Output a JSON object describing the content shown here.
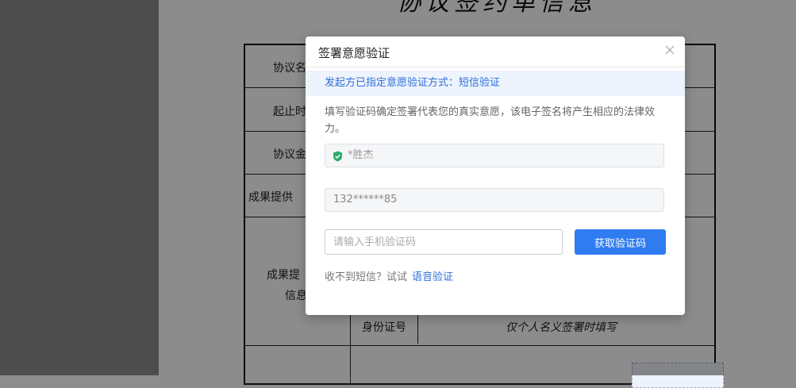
{
  "document": {
    "title": "协议签约单信息",
    "labels": [
      "协议名",
      "起止时",
      "协议金",
      "成果提供",
      "成果提",
      "信息",
      "身份证号"
    ],
    "id_note": "仅个人名义签署时填写"
  },
  "modal": {
    "title": "签署意愿验证",
    "notice": "发起方已指定意愿验证方式：短信验证",
    "description": "填写验证码确定签署代表您的真实意愿，该电子签名将产生相应的法律效力。",
    "name_value": "*胜杰",
    "phone_value": "132******85",
    "code_placeholder": "请输入手机验证码",
    "get_code_label": "获取验证码",
    "no_sms_text": "收不到短信？试试",
    "voice_link": "语音验证"
  },
  "colors": {
    "accent": "#2f7cf0",
    "link": "#2f6fd8",
    "shield": "#2bab6e"
  }
}
